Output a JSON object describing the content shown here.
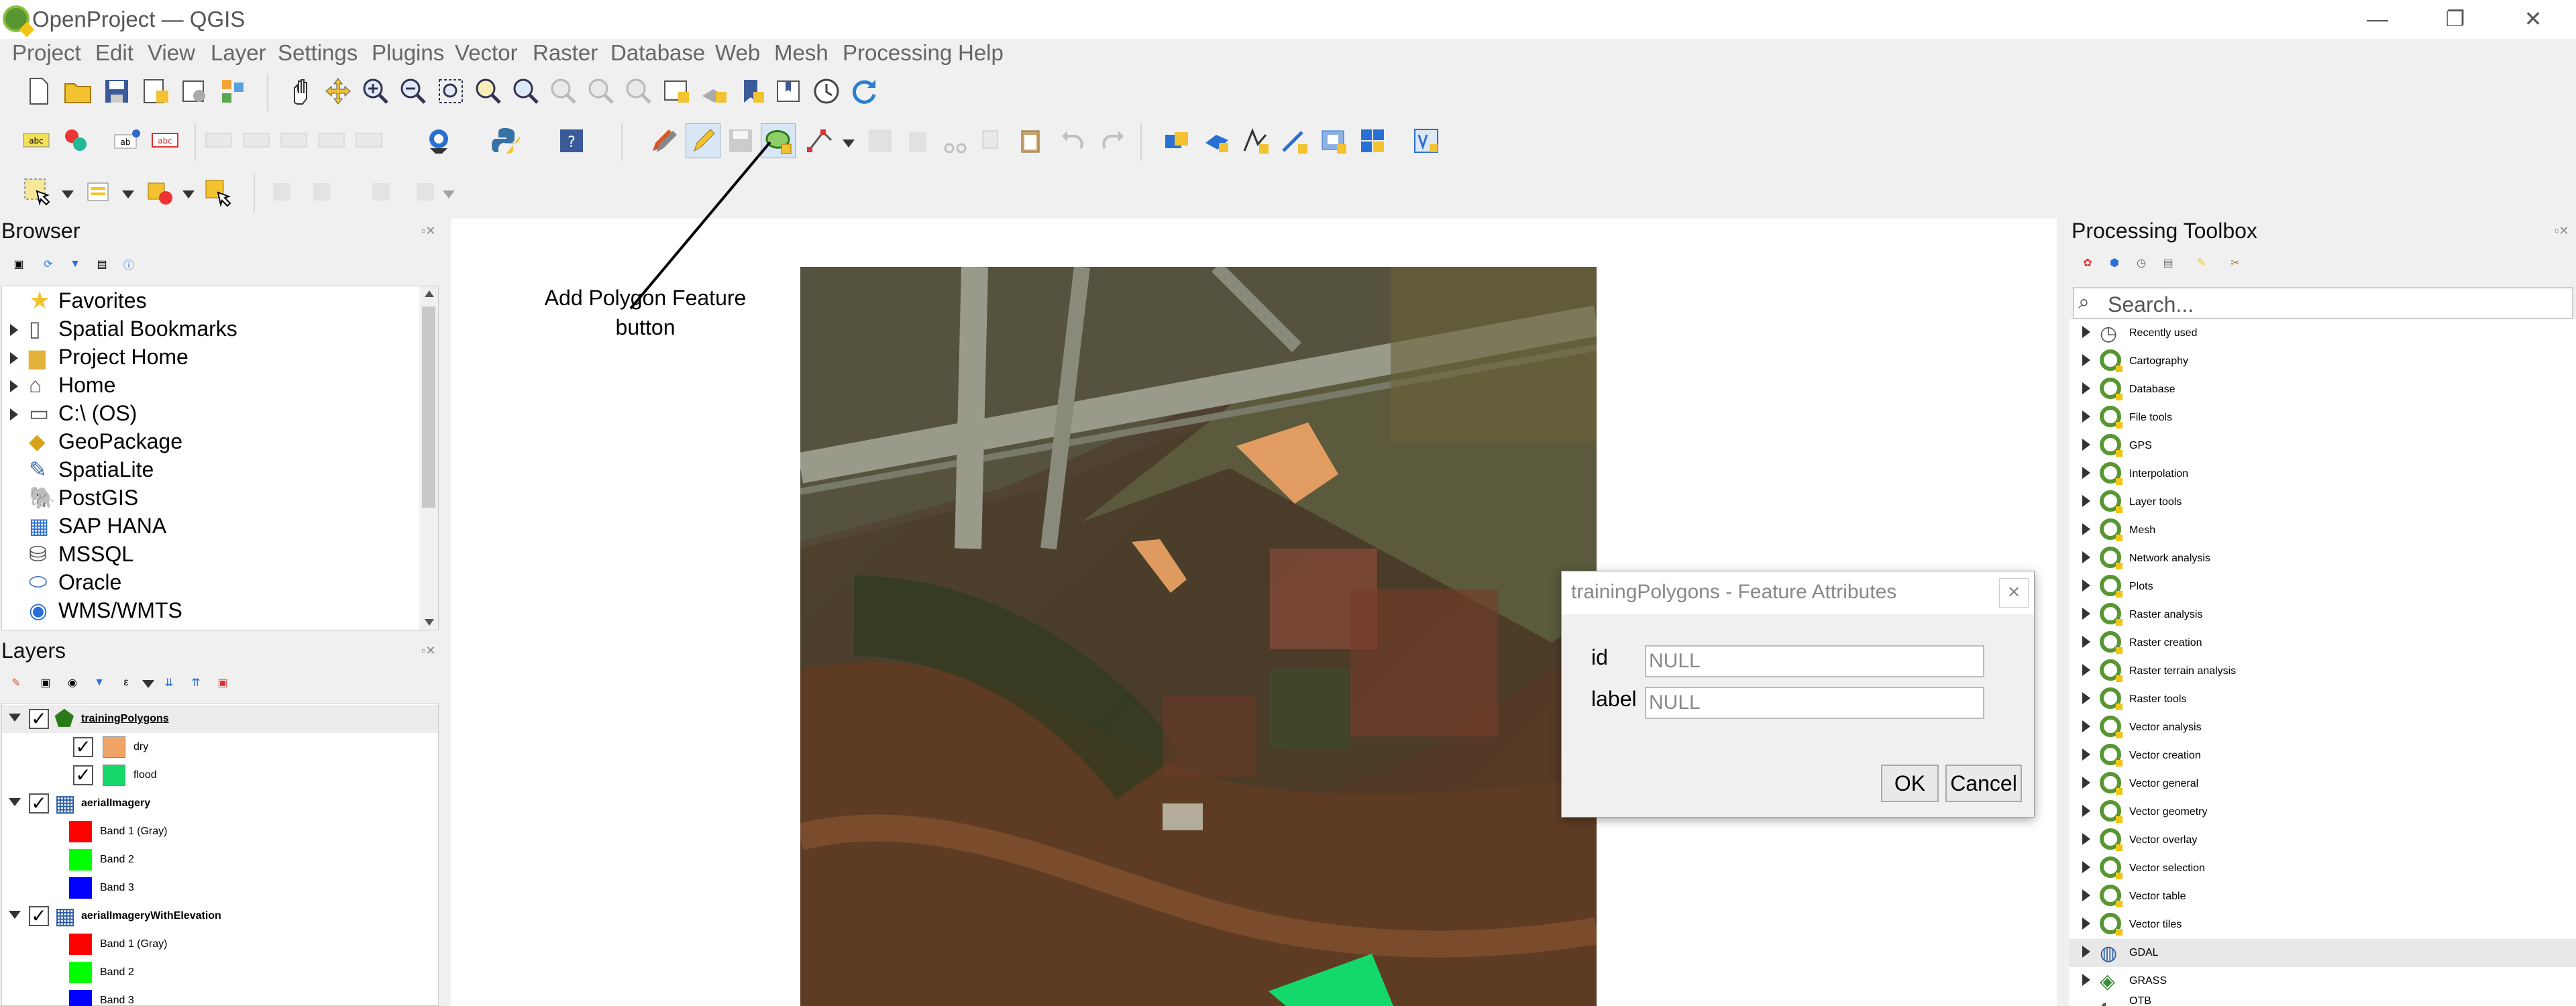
{
  "window": {
    "title": "OpenProject — QGIS",
    "minimize": "—",
    "restore": "❐",
    "close": "✕"
  },
  "menu": [
    "Project",
    "Edit",
    "View",
    "Layer",
    "Settings",
    "Plugins",
    "Vector",
    "Raster",
    "Database",
    "Web",
    "Mesh",
    "Processing",
    "Help"
  ],
  "browser": {
    "title": "Browser",
    "items": [
      "Favorites",
      "Spatial Bookmarks",
      "Project Home",
      "Home",
      "C:\\ (OS)",
      "GeoPackage",
      "SpatiaLite",
      "PostGIS",
      "SAP HANA",
      "MSSQL",
      "Oracle",
      "WMS/WMTS"
    ]
  },
  "layers": {
    "title": "Layers",
    "tree": [
      {
        "name": "trainingPolygons",
        "type": "group",
        "checked": true
      },
      {
        "name": "dry",
        "type": "class",
        "color": "#f0a465",
        "checked": true
      },
      {
        "name": "flood",
        "type": "class",
        "color": "#14d96a",
        "checked": true
      },
      {
        "name": "aerialImagery",
        "type": "group",
        "checked": true
      },
      {
        "name": "Band 1 (Gray)",
        "type": "band",
        "color": "#ff0000"
      },
      {
        "name": "Band 2",
        "type": "band",
        "color": "#00ff00"
      },
      {
        "name": "Band 3",
        "type": "band",
        "color": "#0000ff"
      },
      {
        "name": "aerialImageryWithElevation",
        "type": "group",
        "checked": true
      },
      {
        "name": "Band 1 (Gray)",
        "type": "band",
        "color": "#ff0000"
      },
      {
        "name": "Band 2",
        "type": "band",
        "color": "#00ff00"
      },
      {
        "name": "Band 3",
        "type": "band",
        "color": "#0000ff"
      }
    ]
  },
  "annotation": {
    "line1": "Add Polygon Feature",
    "line2": "button"
  },
  "dialog": {
    "title": "trainingPolygons - Feature Attributes",
    "fields": [
      {
        "label": "id",
        "value": "NULL"
      },
      {
        "label": "label",
        "value": "NULL"
      }
    ],
    "ok": "OK",
    "cancel": "Cancel",
    "close": "✕"
  },
  "toolbox": {
    "title": "Processing Toolbox",
    "search_placeholder": "Search...",
    "items": [
      "Recently used",
      "Cartography",
      "Database",
      "File tools",
      "GPS",
      "Interpolation",
      "Layer tools",
      "Mesh",
      "Network analysis",
      "Plots",
      "Raster analysis",
      "Raster creation",
      "Raster terrain analysis",
      "Raster tools",
      "Vector analysis",
      "Vector creation",
      "Vector general",
      "Vector geometry",
      "Vector overlay",
      "Vector selection",
      "Vector table",
      "Vector tiles",
      "GDAL",
      "GRASS",
      "OTB"
    ]
  },
  "colors": {
    "dry": "#f0a465",
    "flood": "#14d96a",
    "qgis_green": "#589632"
  }
}
